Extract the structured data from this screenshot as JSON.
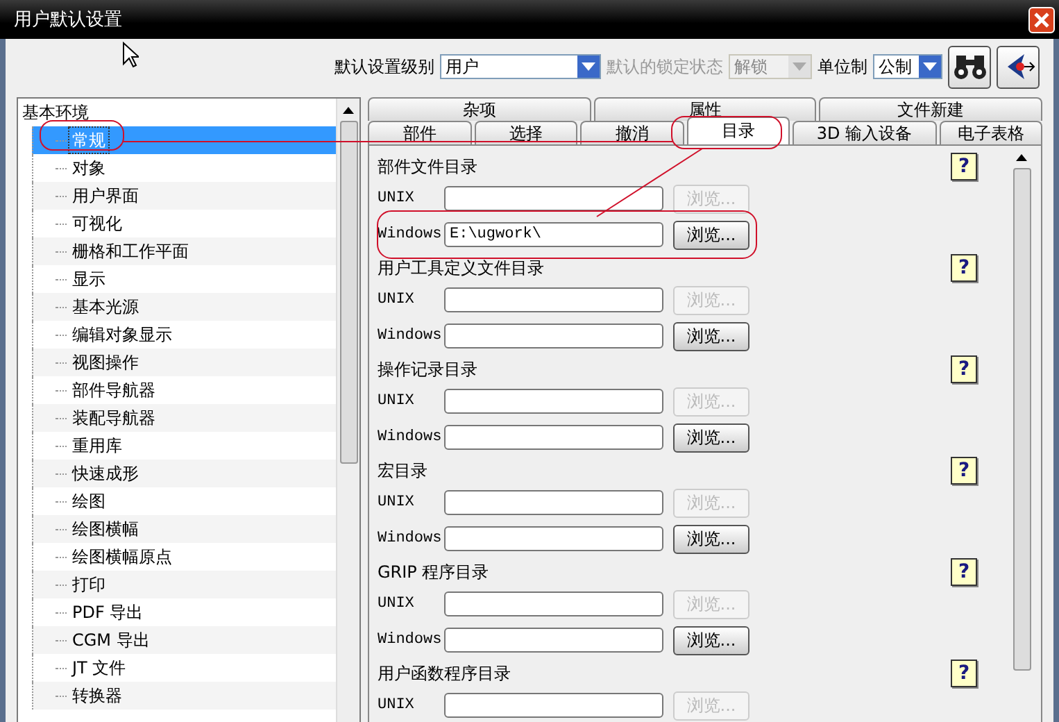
{
  "window": {
    "title": "用户默认设置",
    "cursor_visible": true
  },
  "toolbar": {
    "fields": [
      {
        "label": "默认设置级别",
        "value": "用户",
        "disabled": false,
        "kind": "wide"
      },
      {
        "label": "默认的锁定状态",
        "value": "解锁",
        "disabled": true,
        "kind": "mid"
      },
      {
        "label": "单位制",
        "value": "公制",
        "disabled": false,
        "kind": "narrow"
      }
    ]
  },
  "tree": {
    "root": "基本环境",
    "children": [
      {
        "label": "常规",
        "selected": true
      },
      {
        "label": "对象",
        "selected": false
      },
      {
        "label": "用户界面",
        "selected": false
      },
      {
        "label": "可视化",
        "selected": false
      },
      {
        "label": "栅格和工作平面",
        "selected": false
      },
      {
        "label": "显示",
        "selected": false
      },
      {
        "label": "基本光源",
        "selected": false
      },
      {
        "label": "编辑对象显示",
        "selected": false
      },
      {
        "label": "视图操作",
        "selected": false
      },
      {
        "label": "部件导航器",
        "selected": false
      },
      {
        "label": "装配导航器",
        "selected": false
      },
      {
        "label": "重用库",
        "selected": false
      },
      {
        "label": "快速成形",
        "selected": false
      },
      {
        "label": "绘图",
        "selected": false
      },
      {
        "label": "绘图横幅",
        "selected": false
      },
      {
        "label": "绘图横幅原点",
        "selected": false
      },
      {
        "label": "打印",
        "selected": false
      },
      {
        "label": "PDF 导出",
        "selected": false
      },
      {
        "label": "CGM 导出",
        "selected": false
      },
      {
        "label": "JT 文件",
        "selected": false
      },
      {
        "label": "转换器",
        "selected": false
      }
    ]
  },
  "tab_rows": [
    [
      {
        "label": "杂项",
        "selected": false
      },
      {
        "label": "属性",
        "selected": false
      },
      {
        "label": "文件新建",
        "selected": false
      }
    ],
    [
      {
        "label": "部件",
        "selected": false
      },
      {
        "label": "选择",
        "selected": false
      },
      {
        "label": "撤消",
        "selected": false
      },
      {
        "label": "目录",
        "selected": true
      },
      {
        "label": "3D 输入设备",
        "selected": false
      },
      {
        "label": "电子表格",
        "selected": false
      }
    ]
  ],
  "sections": [
    {
      "heading": "部件文件目录",
      "help": "?",
      "rows": [
        {
          "label": "UNIX",
          "value": "",
          "button": "浏览...",
          "disabled": true
        },
        {
          "label": "Windows",
          "value": "E:\\ugwork\\",
          "button": "浏览...",
          "disabled": false
        }
      ]
    },
    {
      "heading": "用户工具定义文件目录",
      "help": "?",
      "rows": [
        {
          "label": "UNIX",
          "value": "",
          "button": "浏览...",
          "disabled": true
        },
        {
          "label": "Windows",
          "value": "",
          "button": "浏览...",
          "disabled": false
        }
      ]
    },
    {
      "heading": "操作记录目录",
      "help": "?",
      "rows": [
        {
          "label": "UNIX",
          "value": "",
          "button": "浏览...",
          "disabled": true
        },
        {
          "label": "Windows",
          "value": "",
          "button": "浏览...",
          "disabled": false
        }
      ]
    },
    {
      "heading": "宏目录",
      "help": "?",
      "rows": [
        {
          "label": "UNIX",
          "value": "",
          "button": "浏览...",
          "disabled": true
        },
        {
          "label": "Windows",
          "value": "",
          "button": "浏览...",
          "disabled": false
        }
      ]
    },
    {
      "heading": "GRIP 程序目录",
      "help": "?",
      "rows": [
        {
          "label": "UNIX",
          "value": "",
          "button": "浏览...",
          "disabled": true
        },
        {
          "label": "Windows",
          "value": "",
          "button": "浏览...",
          "disabled": false
        }
      ]
    },
    {
      "heading": "用户函数程序目录",
      "help": "?",
      "rows": [
        {
          "label": "UNIX",
          "value": "",
          "button": "浏览...",
          "disabled": true
        }
      ]
    }
  ],
  "annotation": {
    "kind": "red-callouts"
  }
}
